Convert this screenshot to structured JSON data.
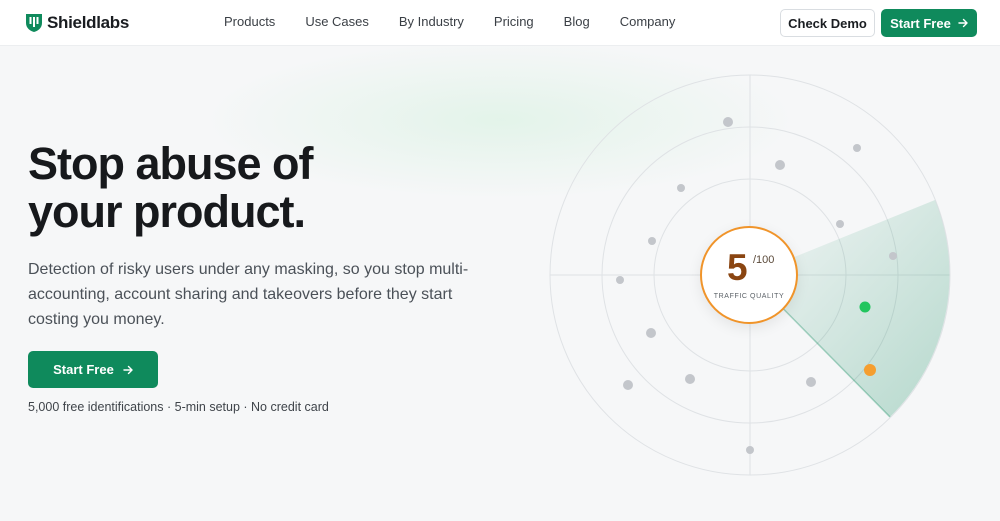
{
  "brand": {
    "name": "Shieldlabs",
    "color": "#0f8a5c"
  },
  "nav": {
    "items": [
      "Products",
      "Use Cases",
      "By Industry",
      "Pricing",
      "Blog",
      "Company"
    ]
  },
  "header": {
    "check_demo": "Check Demo",
    "start_free": "Start Free"
  },
  "hero": {
    "title_line1": "Stop abuse of",
    "title_line2": "your product.",
    "description": "Detection of risky users under any masking, so you stop multi-accounting, account sharing and takeovers before they start costing you money.",
    "cta": "Start Free",
    "note": "5,000 free identifications · 5-min setup · No credit card"
  },
  "score": {
    "value": "5",
    "denominator": "/100",
    "label": "TRAFFIC QUALITY",
    "accent": "#f0942a"
  },
  "icons": {
    "arrow": "arrow-right-icon",
    "logo": "shield-logo-icon"
  }
}
